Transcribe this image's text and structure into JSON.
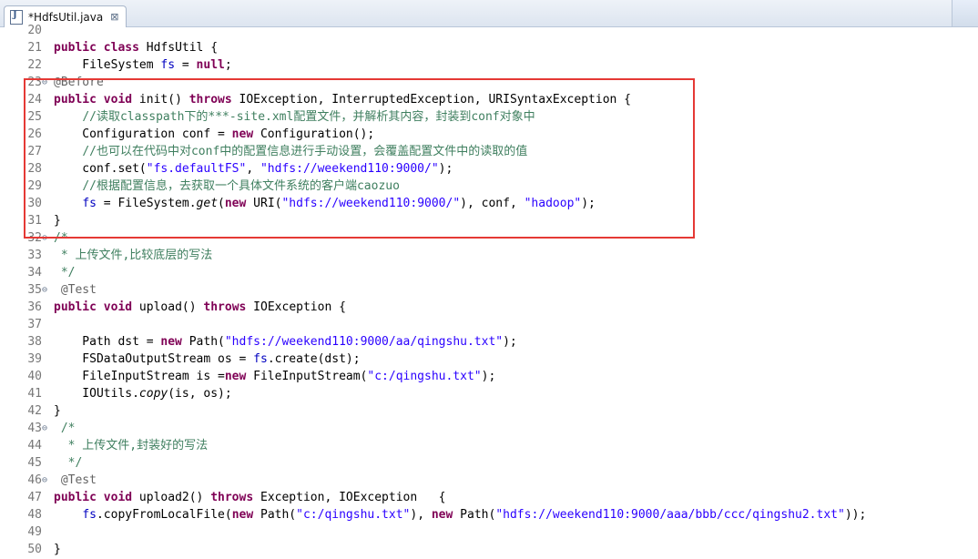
{
  "tab": {
    "title": "*HdfsUtil.java",
    "icon": "java-file-icon",
    "close": "⊠"
  },
  "lines": [
    {
      "num": "20",
      "fold": "",
      "html": ""
    },
    {
      "num": "21",
      "fold": "",
      "html": "<span class='kw'>public</span> <span class='kw'>class</span> HdfsUtil {"
    },
    {
      "num": "22",
      "fold": "",
      "html": "    FileSystem <span class='field'>fs</span> = <span class='kw'>null</span>;"
    },
    {
      "num": "23",
      "fold": "⊖",
      "html": "<span class='ann'>@Before</span>"
    },
    {
      "num": "24",
      "fold": "",
      "html": "<span class='kw'>public</span> <span class='kw'>void</span> init() <span class='kw'>throws</span> IOException, InterruptedException, URISyntaxException {"
    },
    {
      "num": "25",
      "fold": "",
      "html": "    <span class='com'>//读取classpath下的***-site.xml配置文件，并解析其内容，封装到conf对象中</span>"
    },
    {
      "num": "26",
      "fold": "",
      "html": "    Configuration conf = <span class='kw'>new</span> Configuration();"
    },
    {
      "num": "27",
      "fold": "",
      "html": "    <span class='com'>//也可以在代码中对conf中的配置信息进行手动设置，会覆盖配置文件中的读取的值</span>"
    },
    {
      "num": "28",
      "fold": "",
      "html": "    conf.set(<span class='str'>\"fs.defaultFS\"</span>, <span class='str'>\"hdfs://weekend110:9000/\"</span>);"
    },
    {
      "num": "29",
      "fold": "",
      "html": "    <span class='com'>//根据配置信息，去获取一个具体文件系统的客户端caozuo</span>"
    },
    {
      "num": "30",
      "fold": "",
      "html": "    <span class='field'>fs</span> = FileSystem.<span class='italic'>get</span>(<span class='kw'>new</span> URI(<span class='str'>\"hdfs://weekend110:9000/\"</span>), conf, <span class='str'>\"hadoop\"</span>);"
    },
    {
      "num": "31",
      "fold": "",
      "html": "}"
    },
    {
      "num": "32",
      "fold": "⊖",
      "html": "<span class='com'>/*</span>"
    },
    {
      "num": "33",
      "fold": "",
      "html": "<span class='com'> * 上传文件,比较底层的写法</span>"
    },
    {
      "num": "34",
      "fold": "",
      "html": "<span class='com'> */</span>"
    },
    {
      "num": "35",
      "fold": "⊖",
      "html": " <span class='ann'>@Test</span>"
    },
    {
      "num": "36",
      "fold": "",
      "html": "<span class='kw'>public</span> <span class='kw'>void</span> upload() <span class='kw'>throws</span> IOException {"
    },
    {
      "num": "37",
      "fold": "",
      "html": ""
    },
    {
      "num": "38",
      "fold": "",
      "html": "    Path dst = <span class='kw'>new</span> Path(<span class='str'>\"hdfs://weekend110:9000/aa/qingshu.txt\"</span>);"
    },
    {
      "num": "39",
      "fold": "",
      "html": "    FSDataOutputStream os = <span class='field'>fs</span>.create(dst);"
    },
    {
      "num": "40",
      "fold": "",
      "html": "    FileInputStream is =<span class='kw'>new</span> FileInputStream(<span class='str'>\"c:/qingshu.txt\"</span>);"
    },
    {
      "num": "41",
      "fold": "",
      "html": "    IOUtils.<span class='italic'>copy</span>(is, os);"
    },
    {
      "num": "42",
      "fold": "",
      "html": "}"
    },
    {
      "num": "43",
      "fold": "⊖",
      "html": " <span class='com'>/*</span>"
    },
    {
      "num": "44",
      "fold": "",
      "html": "<span class='com'>  * 上传文件,封装好的写法</span>"
    },
    {
      "num": "45",
      "fold": "",
      "html": "<span class='com'>  */</span>"
    },
    {
      "num": "46",
      "fold": "⊖",
      "html": " <span class='ann'>@Test</span>"
    },
    {
      "num": "47",
      "fold": "",
      "html": "<span class='kw'>public</span> <span class='kw'>void</span> upload2() <span class='kw'>throws</span> Exception, IOException   {"
    },
    {
      "num": "48",
      "fold": "",
      "html": "    <span class='field'>fs</span>.copyFromLocalFile(<span class='kw'>new</span> Path(<span class='str'>\"c:/qingshu.txt\"</span>), <span class='kw'>new</span> Path(<span class='str'>\"hdfs://weekend110:9000/aaa/bbb/ccc/qingshu2.txt\"</span>));"
    },
    {
      "num": "49",
      "fold": "",
      "html": ""
    },
    {
      "num": "50",
      "fold": "",
      "html": "}"
    }
  ],
  "colors": {
    "keyword": "#7f0055",
    "string": "#2a00ff",
    "comment": "#3f7f5f",
    "annotation": "#646464",
    "field": "#0000c0",
    "highlight": "#e53935"
  }
}
